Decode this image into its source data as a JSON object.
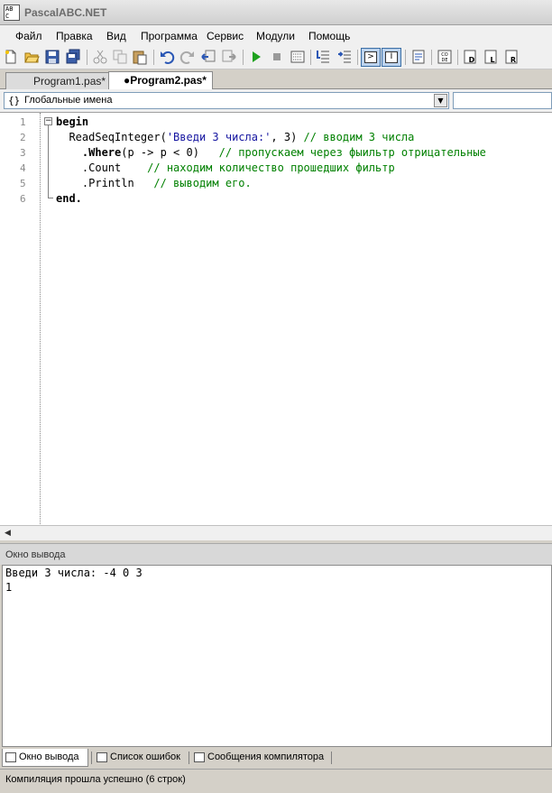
{
  "window": {
    "title": "PascalABC.NET",
    "icon_text": "AB C"
  },
  "menu": [
    "Файл",
    "Правка",
    "Вид",
    "Программа",
    "Сервис",
    "Модули",
    "Помощь"
  ],
  "tabs": [
    {
      "label": "Program1.pas*",
      "active": false
    },
    {
      "label": "●Program2.pas*",
      "active": true
    }
  ],
  "scope_selector": {
    "icon": "{}",
    "value": "Глобальные имена"
  },
  "editor": {
    "line_numbers": [
      "1",
      "2",
      "3",
      "4",
      "5",
      "6"
    ],
    "lines": [
      [
        {
          "t": "begin",
          "c": "kw"
        }
      ],
      [
        {
          "t": "  ReadSeqInteger(",
          "c": "plain"
        },
        {
          "t": "'Введи 3 числа:'",
          "c": "str"
        },
        {
          "t": ", 3) ",
          "c": "plain"
        },
        {
          "t": "// вводим 3 числа",
          "c": "cmt"
        }
      ],
      [
        {
          "t": "    .Where",
          "c": "kw"
        },
        {
          "t": "(p -> p < 0)   ",
          "c": "plain"
        },
        {
          "t": "// пропускаем через фыильтр отрицательные",
          "c": "cmt"
        }
      ],
      [
        {
          "t": "    .Count    ",
          "c": "plain"
        },
        {
          "t": "// находим количество прошедших фильтр",
          "c": "cmt"
        }
      ],
      [
        {
          "t": "    .Println   ",
          "c": "plain"
        },
        {
          "t": "// выводим его.",
          "c": "cmt"
        }
      ],
      [
        {
          "t": "end.",
          "c": "kw"
        }
      ]
    ]
  },
  "output_panel": {
    "title": "Окно вывода",
    "lines": [
      "Введи 3 числа: -4 0 3",
      "1"
    ]
  },
  "bottom_tabs": [
    "Окно вывода",
    "Список ошибок",
    "Сообщения компилятора"
  ],
  "status": "Компиляция прошла успешно (6 строк)",
  "icons": {
    "toolbar": [
      "new-file-icon",
      "open-folder-icon",
      "save-icon",
      "save-all-icon",
      "cut-icon",
      "copy-icon",
      "paste-icon",
      "undo-icon",
      "redo-icon",
      "back-icon",
      "forward-icon",
      "run-icon",
      "stop-icon",
      "compile-icon",
      "step-into-icon",
      "step-over-icon",
      "console-toggle-icon",
      "form-toggle-icon",
      "document-icon",
      "code-icon",
      "unit-d-icon",
      "unit-l-icon",
      "unit-r-icon"
    ]
  },
  "colors": {
    "comment": "#008000",
    "string": "#1515a0",
    "toggle_active": "#bcd3ee"
  }
}
